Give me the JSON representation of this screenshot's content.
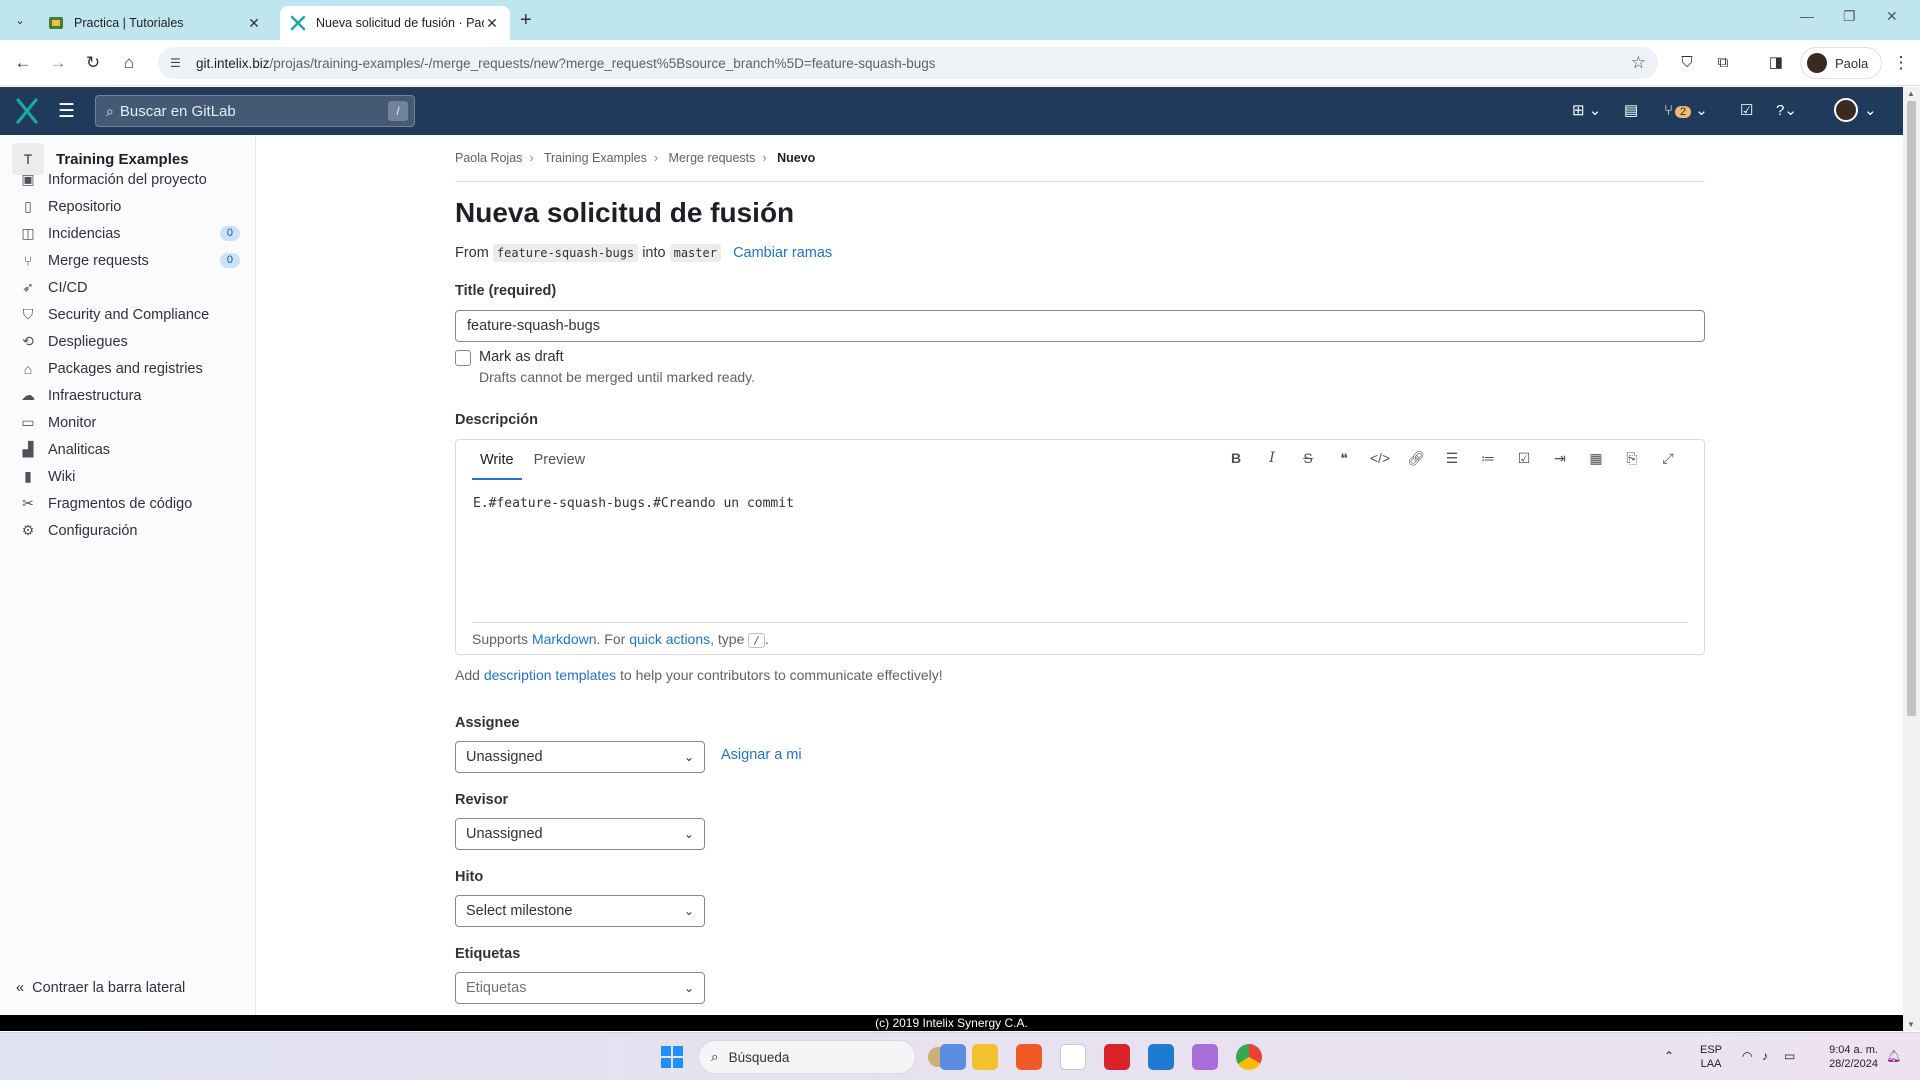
{
  "browser": {
    "tabs": [
      {
        "title": "Practica | Tutoriales",
        "active": false
      },
      {
        "title": "Nueva solicitud de fusión · Paola",
        "active": true
      }
    ],
    "url_host": "git.intelix.biz",
    "url_path": "/projas/training-examples/-/merge_requests/new?merge_request%5Bsource_branch%5D=feature-squash-bugs",
    "profile_name": "Paola"
  },
  "header": {
    "search_placeholder": "Buscar en GitLab",
    "search_shortcut": "/",
    "mr_count": "2"
  },
  "sidebar": {
    "project_initial": "T",
    "project_name": "Training Examples",
    "items": [
      {
        "label": "Información del proyecto",
        "icon": "project-icon"
      },
      {
        "label": "Repositorio",
        "icon": "doc-icon"
      },
      {
        "label": "Incidencias",
        "icon": "issues-icon",
        "count": "0"
      },
      {
        "label": "Merge requests",
        "icon": "merge-request-icon",
        "count": "0"
      },
      {
        "label": "CI/CD",
        "icon": "rocket-icon"
      },
      {
        "label": "Security and Compliance",
        "icon": "shield-icon"
      },
      {
        "label": "Despliegues",
        "icon": "deployments-icon"
      },
      {
        "label": "Packages and registries",
        "icon": "package-icon"
      },
      {
        "label": "Infraestructura",
        "icon": "cloud-icon"
      },
      {
        "label": "Monitor",
        "icon": "monitor-icon"
      },
      {
        "label": "Analiticas",
        "icon": "chart-icon"
      },
      {
        "label": "Wiki",
        "icon": "book-icon"
      },
      {
        "label": "Fragmentos de código",
        "icon": "snippet-icon"
      },
      {
        "label": "Configuración",
        "icon": "gear-icon"
      }
    ],
    "collapse_label": "Contraer la barra lateral"
  },
  "breadcrumb": [
    "Paola Rojas",
    "Training Examples",
    "Merge requests",
    "Nuevo"
  ],
  "page": {
    "title": "Nueva solicitud de fusión",
    "from_text": "From",
    "source_branch": "feature-squash-bugs",
    "into_text": "into",
    "target_branch": "master",
    "change_branches": "Cambiar ramas",
    "title_label": "Title (required)",
    "title_value": "feature-squash-bugs",
    "draft_label": "Mark as draft",
    "draft_help": "Drafts cannot be merged until marked ready.",
    "description_label": "Descripción",
    "tab_write": "Write",
    "tab_preview": "Preview",
    "description_value": "E.#feature-squash-bugs.#Creando un commit",
    "supports": "Supports",
    "markdown": "Markdown",
    "for_text": ". For",
    "quick_actions": "quick actions",
    "type_text": ", type",
    "slash": "/",
    "templates_prefix": "Add",
    "templates_link": "description templates",
    "templates_suffix": "to help your contributors to communicate effectively!",
    "assignee_label": "Assignee",
    "assignee_value": "Unassigned",
    "assign_me": "Asignar a mi",
    "reviewer_label": "Revisor",
    "reviewer_value": "Unassigned",
    "milestone_label": "Hito",
    "milestone_value": "Select milestone",
    "labels_label": "Etiquetas",
    "labels_value": "Etiquetas"
  },
  "footer": "(c) 2019 Intelix Synergy C.A.",
  "taskbar": {
    "search_placeholder": "Búsqueda",
    "lang_1": "ESP",
    "lang_2": "LAA",
    "time": "9:04 a. m.",
    "date": "28/2/2024"
  },
  "colors": {
    "gitlab_header": "#1f3a5a",
    "link": "#1f75cb",
    "logo_teal": "#1aa8a8"
  }
}
